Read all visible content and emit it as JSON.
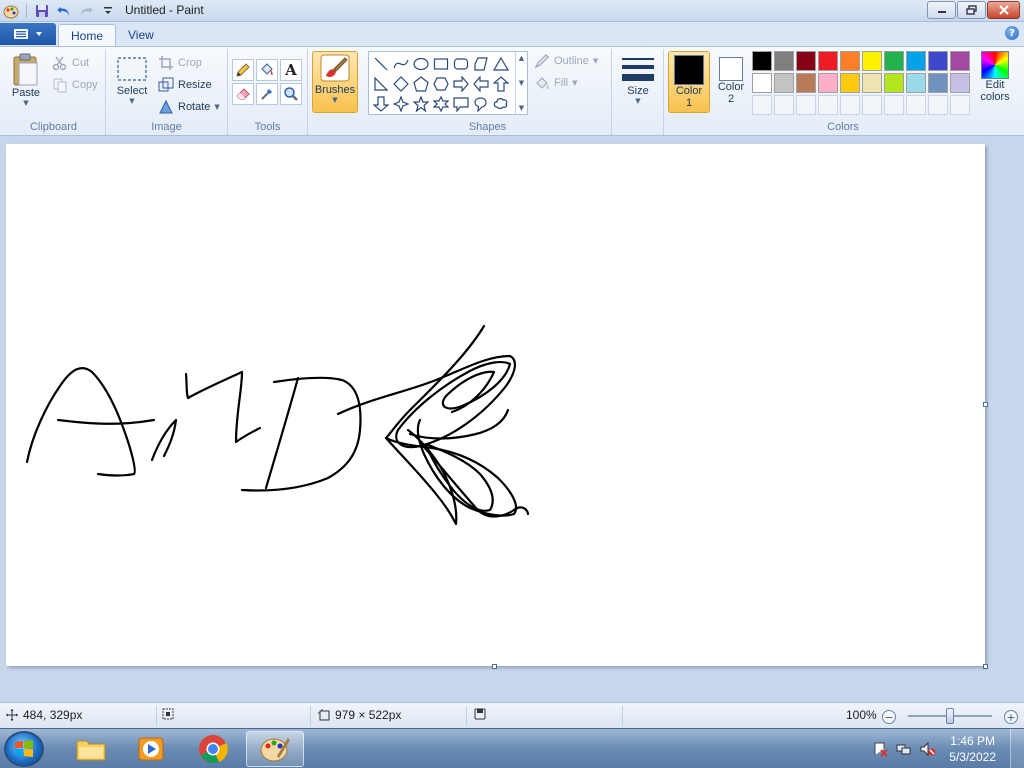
{
  "window": {
    "title": "Untitled - Paint"
  },
  "tabs": [
    {
      "label": "Home",
      "active": true
    },
    {
      "label": "View",
      "active": false
    }
  ],
  "clipboard": {
    "group_label": "Clipboard",
    "paste_label": "Paste",
    "cut_label": "Cut",
    "copy_label": "Copy"
  },
  "image": {
    "group_label": "Image",
    "select_label": "Select",
    "crop_label": "Crop",
    "resize_label": "Resize",
    "rotate_label": "Rotate"
  },
  "tools": {
    "group_label": "Tools",
    "items": [
      "pencil-icon",
      "fill-icon",
      "text-icon",
      "eraser-icon",
      "color-picker-icon",
      "magnifier-icon"
    ]
  },
  "brushes": {
    "label": "Brushes"
  },
  "shapes": {
    "group_label": "Shapes",
    "outline_label": "Outline",
    "fill_label": "Fill"
  },
  "size": {
    "label": "Size"
  },
  "colors": {
    "group_label": "Colors",
    "color1_label_line1": "Color",
    "color1_label_line2": "1",
    "color2_label_line1": "Color",
    "color2_label_line2": "2",
    "color1": "#000000",
    "color2": "#ffffff",
    "edit_label_line1": "Edit",
    "edit_label_line2": "colors",
    "palette_row1": [
      "#000000",
      "#7f7f7f",
      "#880015",
      "#ed1c24",
      "#ff7f27",
      "#fff200",
      "#22b14c",
      "#00a2e8",
      "#3f48cc",
      "#a349a4"
    ],
    "palette_row2": [
      "#ffffff",
      "#c3c3c3",
      "#b97a57",
      "#ffaec9",
      "#ffc90e",
      "#efe4b0",
      "#b5e61d",
      "#99d9ea",
      "#7092be",
      "#c8bfe7"
    ]
  },
  "status": {
    "cursor_pos": "484, 329px",
    "canvas_size": "979 × 522px",
    "zoom": "100%"
  },
  "taskbar": {
    "time": "1:46 PM",
    "date": "5/3/2022"
  }
}
